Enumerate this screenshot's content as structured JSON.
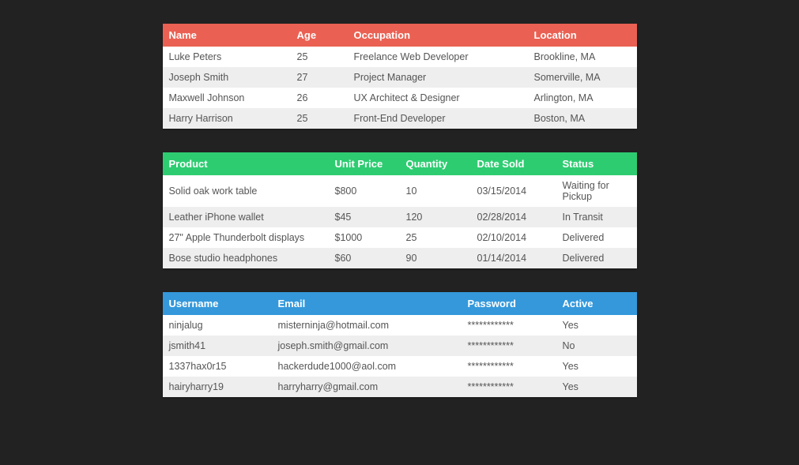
{
  "tables": {
    "people": {
      "headers": [
        "Name",
        "Age",
        "Occupation",
        "Location"
      ],
      "rows": [
        [
          "Luke Peters",
          "25",
          "Freelance Web Developer",
          "Brookline, MA"
        ],
        [
          "Joseph Smith",
          "27",
          "Project Manager",
          "Somerville, MA"
        ],
        [
          "Maxwell Johnson",
          "26",
          "UX Architect & Designer",
          "Arlington, MA"
        ],
        [
          "Harry Harrison",
          "25",
          "Front-End Developer",
          "Boston, MA"
        ]
      ]
    },
    "products": {
      "headers": [
        "Product",
        "Unit Price",
        "Quantity",
        "Date Sold",
        "Status"
      ],
      "rows": [
        [
          "Solid oak work table",
          "$800",
          "10",
          "03/15/2014",
          "Waiting for Pickup"
        ],
        [
          "Leather iPhone wallet",
          "$45",
          "120",
          "02/28/2014",
          "In Transit"
        ],
        [
          "27\" Apple Thunderbolt displays",
          "$1000",
          "25",
          "02/10/2014",
          "Delivered"
        ],
        [
          "Bose studio headphones",
          "$60",
          "90",
          "01/14/2014",
          "Delivered"
        ]
      ]
    },
    "users": {
      "headers": [
        "Username",
        "Email",
        "Password",
        "Active"
      ],
      "rows": [
        [
          "ninjalug",
          "misterninja@hotmail.com",
          "************",
          "Yes"
        ],
        [
          "jsmith41",
          "joseph.smith@gmail.com",
          "************",
          "No"
        ],
        [
          "1337hax0r15",
          "hackerdude1000@aol.com",
          "************",
          "Yes"
        ],
        [
          "hairyharry19",
          "harryharry@gmail.com",
          "************",
          "Yes"
        ]
      ]
    }
  },
  "colwidths": {
    "people": [
      "27%",
      "12%",
      "38%",
      "23%"
    ],
    "products": [
      "35%",
      "15%",
      "15%",
      "18%",
      "17%"
    ],
    "users": [
      "23%",
      "40%",
      "20%",
      "17%"
    ]
  }
}
